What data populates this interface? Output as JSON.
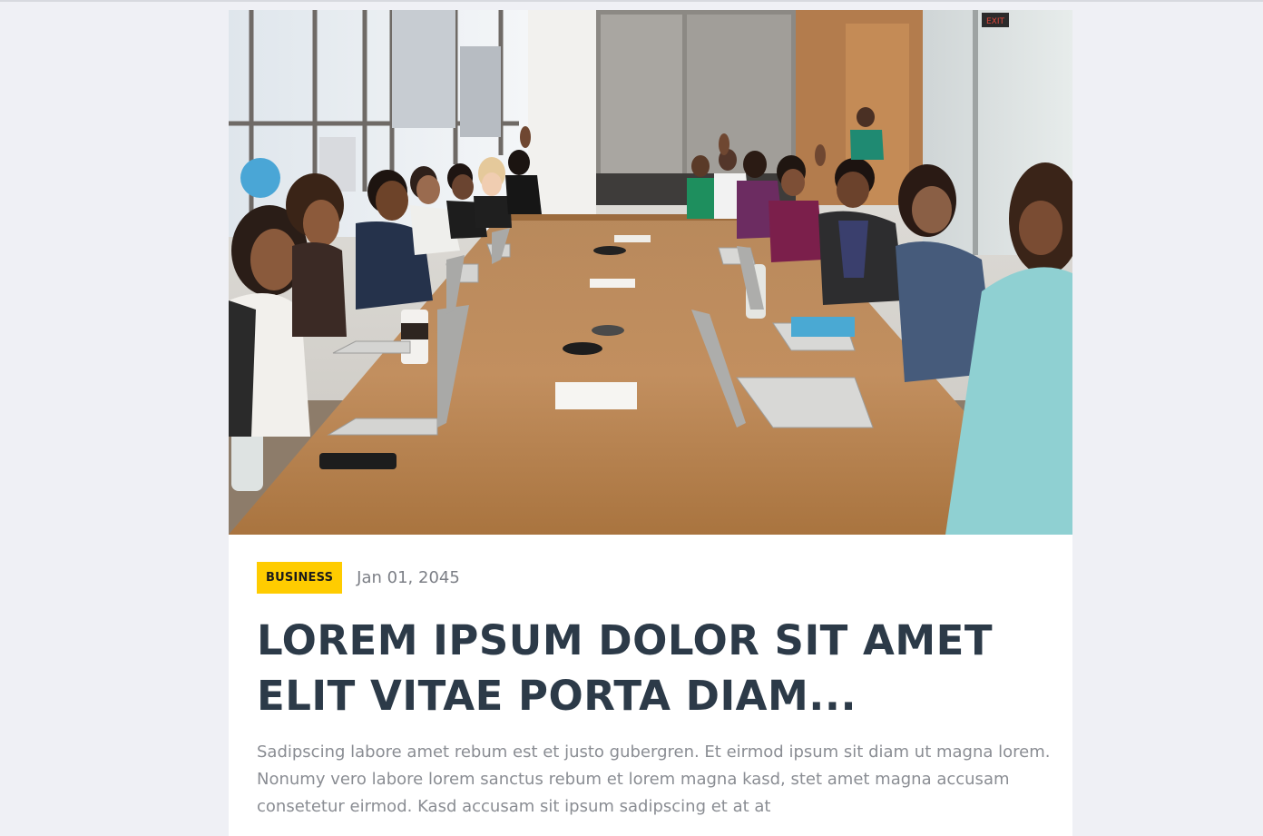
{
  "post": {
    "category": "BUSINESS",
    "date": "Jan 01, 2045",
    "title": "LOREM IPSUM DOLOR SIT AMET ELIT VITAE PORTA DIAM...",
    "excerpt": "Sadipscing labore amet rebum est et justo gubergren. Et eirmod ipsum sit diam ut magna lorem. Nonumy vero labore lorem sanctus rebum et lorem magna kasd, stet amet magna accusam consetetur eirmod. Kasd accusam sit ipsum sadipscing et at at"
  },
  "photo": {
    "exit_sign": "EXIT"
  },
  "colors": {
    "page_bg": "#eff0f5",
    "badge_bg": "#ffcc00",
    "title": "#2c3a48",
    "body": "#8a8d93",
    "date": "#7c7f86"
  }
}
